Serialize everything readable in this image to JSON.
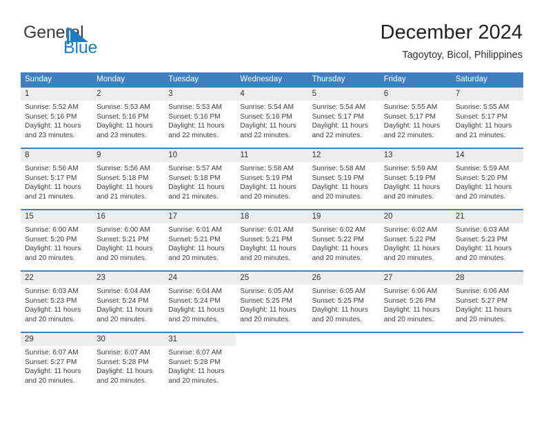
{
  "brand": {
    "word_one": "General",
    "word_two": "Blue",
    "flag_icon": "triangle-flag-icon",
    "accent_color": "#1f7cc0"
  },
  "header": {
    "title": "December 2024",
    "subtitle": "Tagoytoy, Bicol, Philippines"
  },
  "theme": {
    "header_row_bg": "#3f7fbf",
    "daynum_bg": "#ededed",
    "cell_bg": "#ffffff",
    "separator": "#3f7fbf"
  },
  "calendar": {
    "weekday_headers": [
      "Sunday",
      "Monday",
      "Tuesday",
      "Wednesday",
      "Thursday",
      "Friday",
      "Saturday"
    ],
    "labels": {
      "sunrise": "Sunrise:",
      "sunset": "Sunset:",
      "daylight": "Daylight:"
    },
    "weeks": [
      {
        "days": [
          {
            "num": "1",
            "sunrise": "Sunrise: 5:52 AM",
            "sunset": "Sunset: 5:16 PM",
            "daylight_1": "Daylight: 11 hours",
            "daylight_2": "and 23 minutes."
          },
          {
            "num": "2",
            "sunrise": "Sunrise: 5:53 AM",
            "sunset": "Sunset: 5:16 PM",
            "daylight_1": "Daylight: 11 hours",
            "daylight_2": "and 23 minutes."
          },
          {
            "num": "3",
            "sunrise": "Sunrise: 5:53 AM",
            "sunset": "Sunset: 5:16 PM",
            "daylight_1": "Daylight: 11 hours",
            "daylight_2": "and 22 minutes."
          },
          {
            "num": "4",
            "sunrise": "Sunrise: 5:54 AM",
            "sunset": "Sunset: 5:16 PM",
            "daylight_1": "Daylight: 11 hours",
            "daylight_2": "and 22 minutes."
          },
          {
            "num": "5",
            "sunrise": "Sunrise: 5:54 AM",
            "sunset": "Sunset: 5:17 PM",
            "daylight_1": "Daylight: 11 hours",
            "daylight_2": "and 22 minutes."
          },
          {
            "num": "6",
            "sunrise": "Sunrise: 5:55 AM",
            "sunset": "Sunset: 5:17 PM",
            "daylight_1": "Daylight: 11 hours",
            "daylight_2": "and 22 minutes."
          },
          {
            "num": "7",
            "sunrise": "Sunrise: 5:55 AM",
            "sunset": "Sunset: 5:17 PM",
            "daylight_1": "Daylight: 11 hours",
            "daylight_2": "and 21 minutes."
          }
        ]
      },
      {
        "days": [
          {
            "num": "8",
            "sunrise": "Sunrise: 5:56 AM",
            "sunset": "Sunset: 5:17 PM",
            "daylight_1": "Daylight: 11 hours",
            "daylight_2": "and 21 minutes."
          },
          {
            "num": "9",
            "sunrise": "Sunrise: 5:56 AM",
            "sunset": "Sunset: 5:18 PM",
            "daylight_1": "Daylight: 11 hours",
            "daylight_2": "and 21 minutes."
          },
          {
            "num": "10",
            "sunrise": "Sunrise: 5:57 AM",
            "sunset": "Sunset: 5:18 PM",
            "daylight_1": "Daylight: 11 hours",
            "daylight_2": "and 21 minutes."
          },
          {
            "num": "11",
            "sunrise": "Sunrise: 5:58 AM",
            "sunset": "Sunset: 5:19 PM",
            "daylight_1": "Daylight: 11 hours",
            "daylight_2": "and 20 minutes."
          },
          {
            "num": "12",
            "sunrise": "Sunrise: 5:58 AM",
            "sunset": "Sunset: 5:19 PM",
            "daylight_1": "Daylight: 11 hours",
            "daylight_2": "and 20 minutes."
          },
          {
            "num": "13",
            "sunrise": "Sunrise: 5:59 AM",
            "sunset": "Sunset: 5:19 PM",
            "daylight_1": "Daylight: 11 hours",
            "daylight_2": "and 20 minutes."
          },
          {
            "num": "14",
            "sunrise": "Sunrise: 5:59 AM",
            "sunset": "Sunset: 5:20 PM",
            "daylight_1": "Daylight: 11 hours",
            "daylight_2": "and 20 minutes."
          }
        ]
      },
      {
        "days": [
          {
            "num": "15",
            "sunrise": "Sunrise: 6:00 AM",
            "sunset": "Sunset: 5:20 PM",
            "daylight_1": "Daylight: 11 hours",
            "daylight_2": "and 20 minutes."
          },
          {
            "num": "16",
            "sunrise": "Sunrise: 6:00 AM",
            "sunset": "Sunset: 5:21 PM",
            "daylight_1": "Daylight: 11 hours",
            "daylight_2": "and 20 minutes."
          },
          {
            "num": "17",
            "sunrise": "Sunrise: 6:01 AM",
            "sunset": "Sunset: 5:21 PM",
            "daylight_1": "Daylight: 11 hours",
            "daylight_2": "and 20 minutes."
          },
          {
            "num": "18",
            "sunrise": "Sunrise: 6:01 AM",
            "sunset": "Sunset: 5:21 PM",
            "daylight_1": "Daylight: 11 hours",
            "daylight_2": "and 20 minutes."
          },
          {
            "num": "19",
            "sunrise": "Sunrise: 6:02 AM",
            "sunset": "Sunset: 5:22 PM",
            "daylight_1": "Daylight: 11 hours",
            "daylight_2": "and 20 minutes."
          },
          {
            "num": "20",
            "sunrise": "Sunrise: 6:02 AM",
            "sunset": "Sunset: 5:22 PM",
            "daylight_1": "Daylight: 11 hours",
            "daylight_2": "and 20 minutes."
          },
          {
            "num": "21",
            "sunrise": "Sunrise: 6:03 AM",
            "sunset": "Sunset: 5:23 PM",
            "daylight_1": "Daylight: 11 hours",
            "daylight_2": "and 20 minutes."
          }
        ]
      },
      {
        "days": [
          {
            "num": "22",
            "sunrise": "Sunrise: 6:03 AM",
            "sunset": "Sunset: 5:23 PM",
            "daylight_1": "Daylight: 11 hours",
            "daylight_2": "and 20 minutes."
          },
          {
            "num": "23",
            "sunrise": "Sunrise: 6:04 AM",
            "sunset": "Sunset: 5:24 PM",
            "daylight_1": "Daylight: 11 hours",
            "daylight_2": "and 20 minutes."
          },
          {
            "num": "24",
            "sunrise": "Sunrise: 6:04 AM",
            "sunset": "Sunset: 5:24 PM",
            "daylight_1": "Daylight: 11 hours",
            "daylight_2": "and 20 minutes."
          },
          {
            "num": "25",
            "sunrise": "Sunrise: 6:05 AM",
            "sunset": "Sunset: 5:25 PM",
            "daylight_1": "Daylight: 11 hours",
            "daylight_2": "and 20 minutes."
          },
          {
            "num": "26",
            "sunrise": "Sunrise: 6:05 AM",
            "sunset": "Sunset: 5:25 PM",
            "daylight_1": "Daylight: 11 hours",
            "daylight_2": "and 20 minutes."
          },
          {
            "num": "27",
            "sunrise": "Sunrise: 6:06 AM",
            "sunset": "Sunset: 5:26 PM",
            "daylight_1": "Daylight: 11 hours",
            "daylight_2": "and 20 minutes."
          },
          {
            "num": "28",
            "sunrise": "Sunrise: 6:06 AM",
            "sunset": "Sunset: 5:27 PM",
            "daylight_1": "Daylight: 11 hours",
            "daylight_2": "and 20 minutes."
          }
        ]
      },
      {
        "days": [
          {
            "num": "29",
            "sunrise": "Sunrise: 6:07 AM",
            "sunset": "Sunset: 5:27 PM",
            "daylight_1": "Daylight: 11 hours",
            "daylight_2": "and 20 minutes."
          },
          {
            "num": "30",
            "sunrise": "Sunrise: 6:07 AM",
            "sunset": "Sunset: 5:28 PM",
            "daylight_1": "Daylight: 11 hours",
            "daylight_2": "and 20 minutes."
          },
          {
            "num": "31",
            "sunrise": "Sunrise: 6:07 AM",
            "sunset": "Sunset: 5:28 PM",
            "daylight_1": "Daylight: 11 hours",
            "daylight_2": "and 20 minutes."
          },
          {
            "num": "",
            "sunrise": "",
            "sunset": "",
            "daylight_1": "",
            "daylight_2": ""
          },
          {
            "num": "",
            "sunrise": "",
            "sunset": "",
            "daylight_1": "",
            "daylight_2": ""
          },
          {
            "num": "",
            "sunrise": "",
            "sunset": "",
            "daylight_1": "",
            "daylight_2": ""
          },
          {
            "num": "",
            "sunrise": "",
            "sunset": "",
            "daylight_1": "",
            "daylight_2": ""
          }
        ]
      }
    ]
  }
}
